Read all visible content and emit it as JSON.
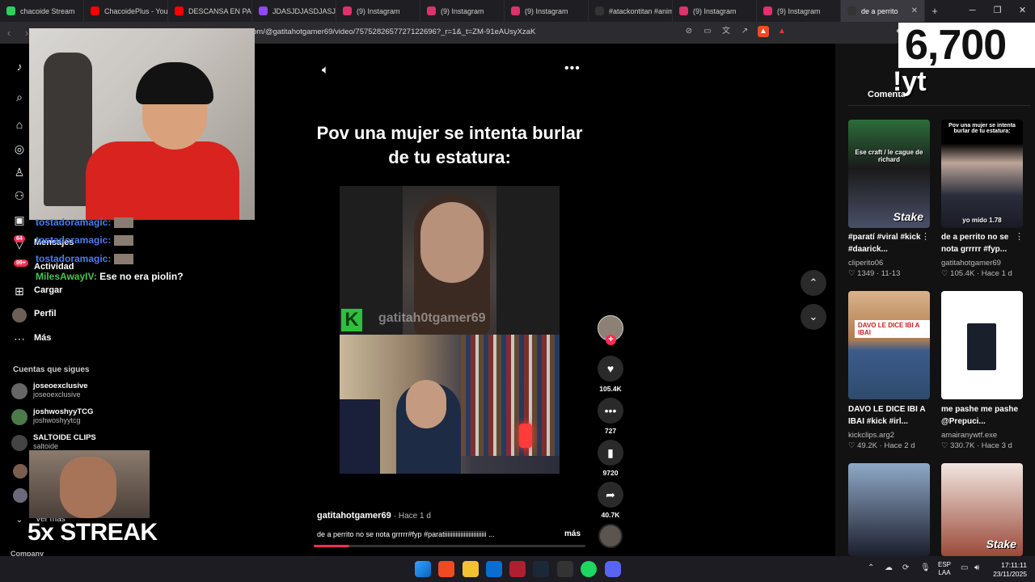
{
  "browser": {
    "tabs": [
      {
        "label": "chacoide Stream",
        "color": "#2bd35a"
      },
      {
        "label": "ChacoidePlus - YouTube",
        "color": "#ff0000"
      },
      {
        "label": "DESCANSA EN PAZ",
        "color": "#ff0000"
      },
      {
        "label": "JDASJDJASDJASJDS",
        "color": "#9146ff"
      },
      {
        "label": "(9) Instagram",
        "color": "#e1306c"
      },
      {
        "label": "(9) Instagram",
        "color": "#e1306c"
      },
      {
        "label": "(9) Instagram",
        "color": "#e1306c"
      },
      {
        "label": "#atackontitan #anime",
        "color": "#111111"
      },
      {
        "label": "(9) Instagram",
        "color": "#e1306c"
      },
      {
        "label": "(9) Instagram",
        "color": "#e1306c"
      },
      {
        "label": "de a perrito",
        "color": "#111111"
      }
    ],
    "url": "om/@gatitahotgamer69/video/7575282657727122696?_r=1&_t=ZM-91eAUsyXzaK"
  },
  "sidebar": {
    "messages_badge": "64",
    "activity_badge": "99+",
    "items": {
      "messages": "Mensajes",
      "activity": "Actividad",
      "upload": "Cargar",
      "profile": "Perfil",
      "more": "Más"
    },
    "following_title": "Cuentas que sigues",
    "following": [
      {
        "name": "joseoexclusive",
        "handle": "joseoexclusive"
      },
      {
        "name": "joshwoshyyTCG",
        "handle": "joshwoshyytcg"
      },
      {
        "name": "SALTOIDE CLIPS",
        "handle": "saltoide"
      }
    ],
    "see_more": "Ver más",
    "company": "Company"
  },
  "chat": [
    {
      "user": "tostadoramagic:",
      "message": ""
    },
    {
      "user": "tostadoramagic:",
      "message": ""
    },
    {
      "user": "tostadoramagic:",
      "message": ""
    },
    {
      "user": "MilesAwayIV:",
      "message": "Ese no era piolin?"
    }
  ],
  "overlay": {
    "streak": "5x STREAK",
    "viewer_count": "6,700",
    "command": "!yt"
  },
  "video": {
    "overlay_text": "Pov una mujer se intenta burlar de tu estatura:",
    "watermark": "gatitah0tgamer69",
    "author": "gatitahotgamer69",
    "posted": "· Hace 1 d",
    "description": "de a perrito no se nota grrrrr#fyp #paratiiiiiiiiiiiiiiiiiiiiiiiiii ...",
    "more_label": "más",
    "progress": 0.13,
    "likes": "105.4K",
    "comments": "727",
    "saves": "9720",
    "shares": "40.7K"
  },
  "right_panel": {
    "tab_label": "Comenta",
    "videos": [
      {
        "title": "#paratí #viral #kick #daarick...",
        "author": "cliperito06",
        "likes": "1349",
        "date": "11-13",
        "thumb_text": "Ese craft / le cague de richard",
        "thumb_brand": "Stake"
      },
      {
        "title": "de a perrito no se nota grrrrr #fyp...",
        "author": "gatitahotgamer69",
        "likes": "105.4K",
        "date": "Hace 1 d",
        "thumb_text": "Pov una mujer se intenta burlar de tu estatura:",
        "thumb_caption": "yo mido 1.78"
      },
      {
        "title": "DAVO LE DICE IBI A IBAI #kick #irl...",
        "author": "kickclips.arg2",
        "likes": "49.2K",
        "date": "Hace 2 d",
        "thumb_text": "DAVO LE DICE IBI A IBAI"
      },
      {
        "title": "me pashe me pashe @Prepuci...",
        "author": "amairanywtf.exe",
        "likes": "330.7K",
        "date": "Hace 3 d"
      }
    ]
  },
  "taskbar": {
    "lang": "ESP",
    "layout": "LAA",
    "time": "17:11:11",
    "date": "23/11/2025"
  }
}
